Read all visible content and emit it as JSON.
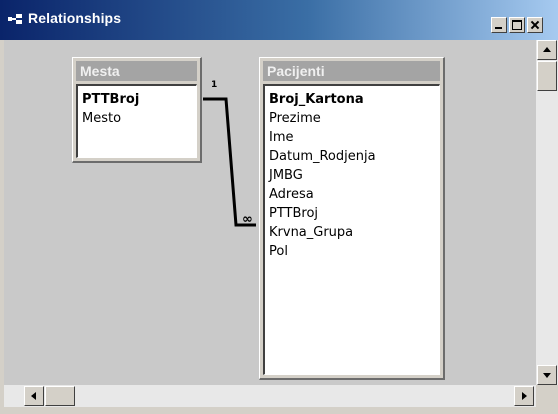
{
  "window": {
    "title": "Relationships",
    "icon": "relationships-icon"
  },
  "title_bar_buttons": [
    "minimize-icon",
    "maximize-icon",
    "close-icon"
  ],
  "tables": {
    "mesta": {
      "name": "Mesta",
      "fields": [
        {
          "label": "PTTBroj",
          "primary_key": true
        },
        {
          "label": "Mesto",
          "primary_key": false
        }
      ]
    },
    "pacijenti": {
      "name": "Pacijenti",
      "fields": [
        {
          "label": "Broj_Kartona",
          "primary_key": true
        },
        {
          "label": "Prezime",
          "primary_key": false
        },
        {
          "label": "Ime",
          "primary_key": false
        },
        {
          "label": "Datum_Rodjenja",
          "primary_key": false
        },
        {
          "label": "JMBG",
          "primary_key": false
        },
        {
          "label": "Adresa",
          "primary_key": false
        },
        {
          "label": "PTTBroj",
          "primary_key": false
        },
        {
          "label": "Krvna_Grupa",
          "primary_key": false
        },
        {
          "label": "Pol",
          "primary_key": false
        }
      ]
    }
  },
  "relationship": {
    "from": "Mesta.PTTBroj",
    "to": "Pacijenti.PTTBroj",
    "one_side_label": "1",
    "many_side_label": "∞"
  },
  "colors": {
    "title_bar_start": "#0a246a",
    "title_bar_end": "#a6caf0",
    "canvas": "#c9c9c9",
    "table_header": "#a4a4a4"
  }
}
